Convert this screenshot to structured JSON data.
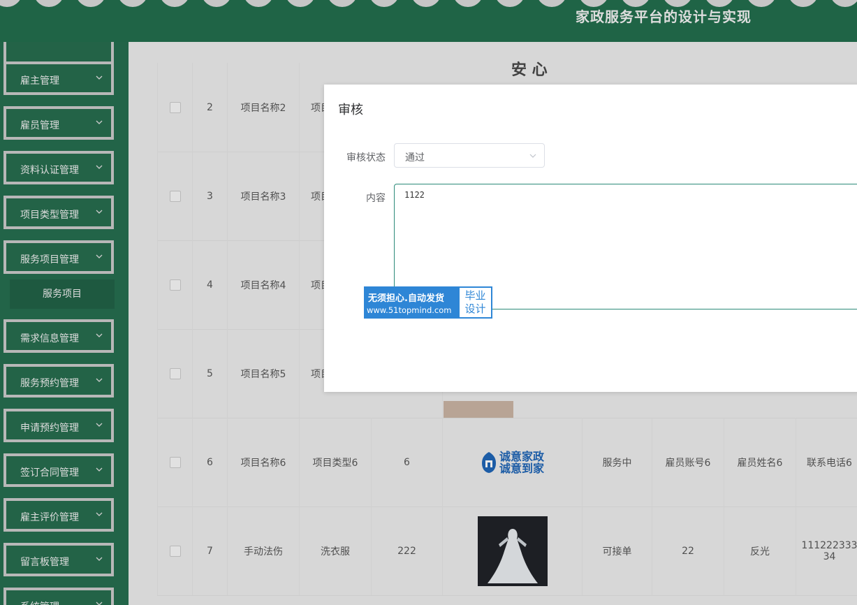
{
  "header": {
    "site_title": "家政服务平台的设计与实现"
  },
  "sidebar": {
    "groups": [
      {
        "label": "雇主管理"
      },
      {
        "label": "雇员管理"
      },
      {
        "label": "资料认证管理"
      },
      {
        "label": "项目类型管理"
      },
      {
        "label": "服务项目管理"
      },
      {
        "label": "需求信息管理"
      },
      {
        "label": "服务预约管理"
      },
      {
        "label": "申请预约管理"
      },
      {
        "label": "签订合同管理"
      },
      {
        "label": "雇主评价管理"
      },
      {
        "label": "留言板管理"
      },
      {
        "label": "系统管理"
      }
    ],
    "active_sub": "服务项目"
  },
  "table": {
    "top_fragment": "安 心",
    "rows": [
      {
        "index": "2",
        "name": "项目名称2",
        "type": "项目",
        "count": "",
        "status": "",
        "account": "",
        "employee": "",
        "phone": ""
      },
      {
        "index": "3",
        "name": "项目名称3",
        "type": "项目",
        "count": "",
        "status": "",
        "account": "",
        "employee": "",
        "phone": ""
      },
      {
        "index": "4",
        "name": "项目名称4",
        "type": "项目",
        "count": "",
        "status": "",
        "account": "",
        "employee": "",
        "phone": ""
      },
      {
        "index": "5",
        "name": "项目名称5",
        "type": "项目",
        "count": "",
        "status": "",
        "account": "",
        "employee": "",
        "phone": ""
      },
      {
        "index": "6",
        "name": "项目名称6",
        "type": "项目类型6",
        "count": "6",
        "status": "服务中",
        "account": "雇员账号6",
        "employee": "雇员姓名6",
        "phone": "联系电话6"
      },
      {
        "index": "7",
        "name": "手动法伤",
        "type": "洗衣服",
        "count": "222",
        "status": "可接单",
        "account": "22",
        "employee": "反光",
        "phone": "11122233334"
      }
    ],
    "logo_text_1": "诚意家政",
    "logo_text_2": "诚意到家"
  },
  "dialog": {
    "title": "审核",
    "status_label": "审核状态",
    "status_value": "通过",
    "content_label": "内容",
    "content_value": "1122"
  },
  "watermark": {
    "line1": "无须担心.自动发货",
    "line2": "www.51topmind.com",
    "badge_line1": "毕业",
    "badge_line2": "设计"
  },
  "icons": {
    "chevron": "chevron-down-icon"
  },
  "colors": {
    "header_bg": "#1f6b4a",
    "sidebar_bg": "#226b4c",
    "accent": "#2b8a78",
    "watermark_blue": "#2e86d6"
  }
}
